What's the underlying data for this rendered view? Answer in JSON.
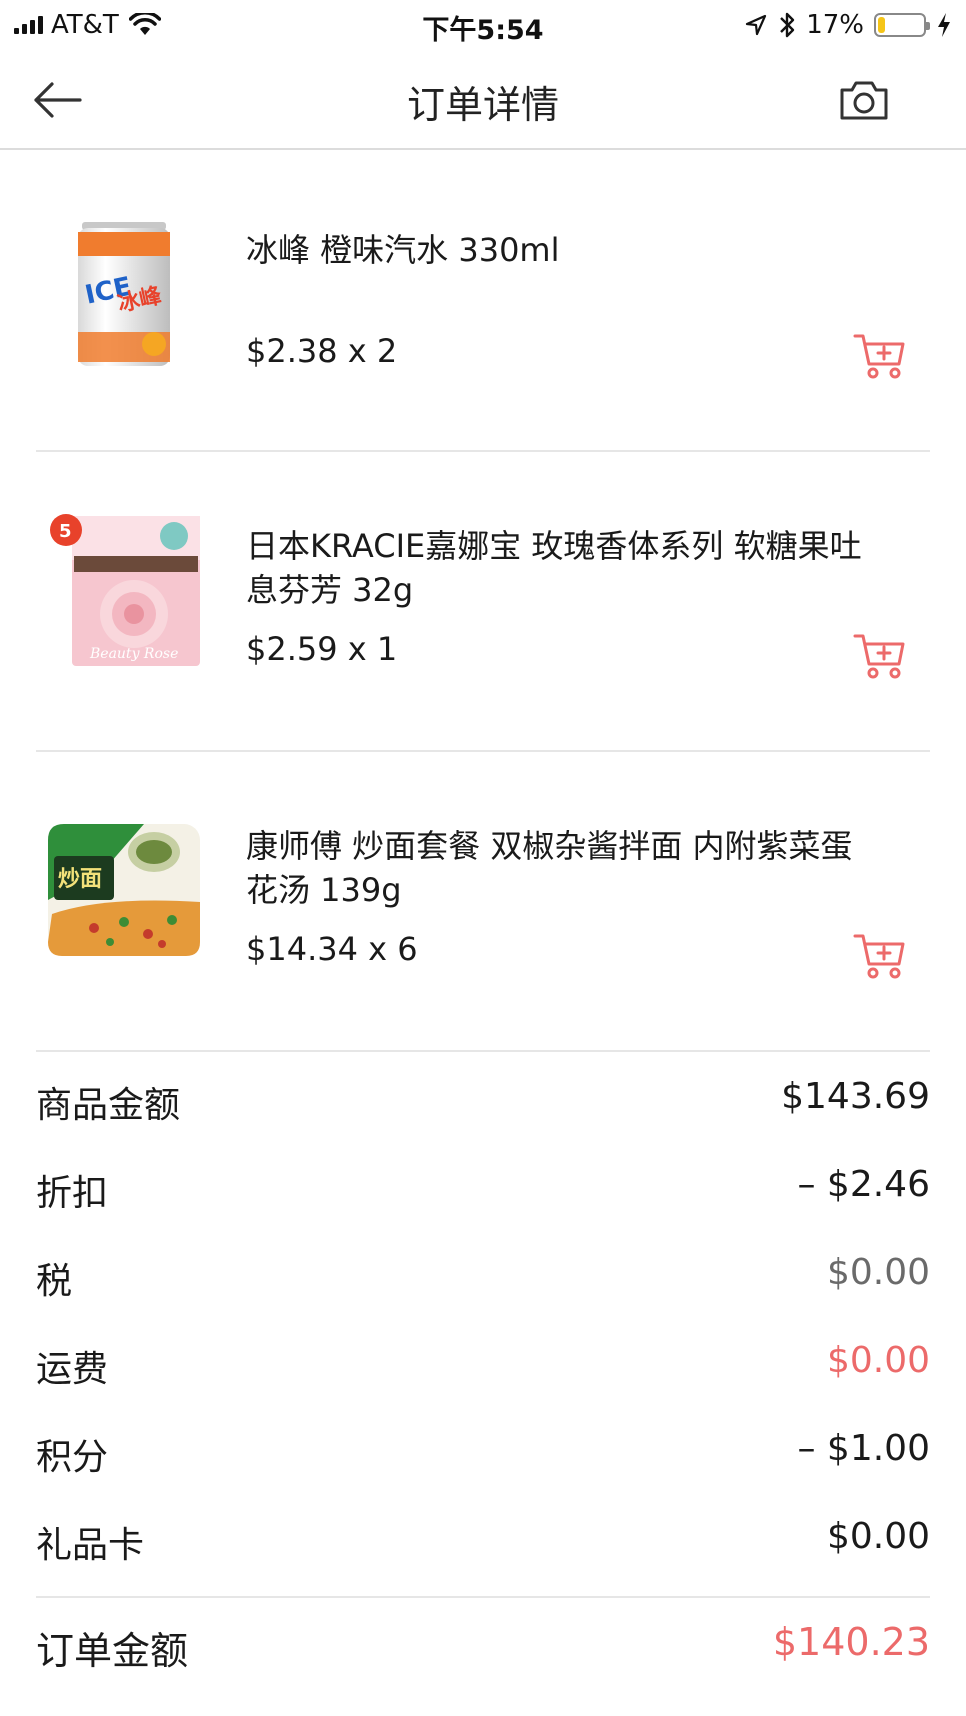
{
  "status_bar": {
    "carrier": "AT&T",
    "time": "下午5:54",
    "battery_percent": "17%",
    "battery_level": 0.17,
    "battery_color": "#f5c518",
    "icons": [
      "signal-icon",
      "wifi-icon",
      "location-icon",
      "bluetooth-icon",
      "battery-icon",
      "charging-icon"
    ]
  },
  "nav": {
    "title": "订单详情",
    "back_icon": "arrow-left-icon",
    "camera_icon": "camera-icon"
  },
  "items": [
    {
      "name": "冰峰 橙味汽水 330ml",
      "price": "$2.38 x 2",
      "image": "orange-soda-can"
    },
    {
      "name": "日本KRACIE嘉娜宝 玫瑰香体系列 软糖果吐息芬芳 32g",
      "price": "$2.59 x 1",
      "image": "rose-candy-pack"
    },
    {
      "name": "康师傅 炒面套餐 双椒杂酱拌面 内附紫菜蛋花汤 139g",
      "price": "$14.34 x 6",
      "image": "instant-noodle-bowl"
    }
  ],
  "summary": {
    "subtotal_label": "商品金额",
    "subtotal_value": "$143.69",
    "discount_label": "折扣",
    "discount_value": "– $2.46",
    "tax_label": "税",
    "tax_value": "$0.00",
    "shipping_label": "运费",
    "shipping_value": "$0.00",
    "points_label": "积分",
    "points_value": "– $1.00",
    "giftcard_label": "礼品卡",
    "giftcard_value": "$0.00",
    "total_label": "订单金额",
    "total_value": "$140.23"
  },
  "colors": {
    "accent": "#ec6a6a",
    "divider": "#e6e6e6"
  }
}
